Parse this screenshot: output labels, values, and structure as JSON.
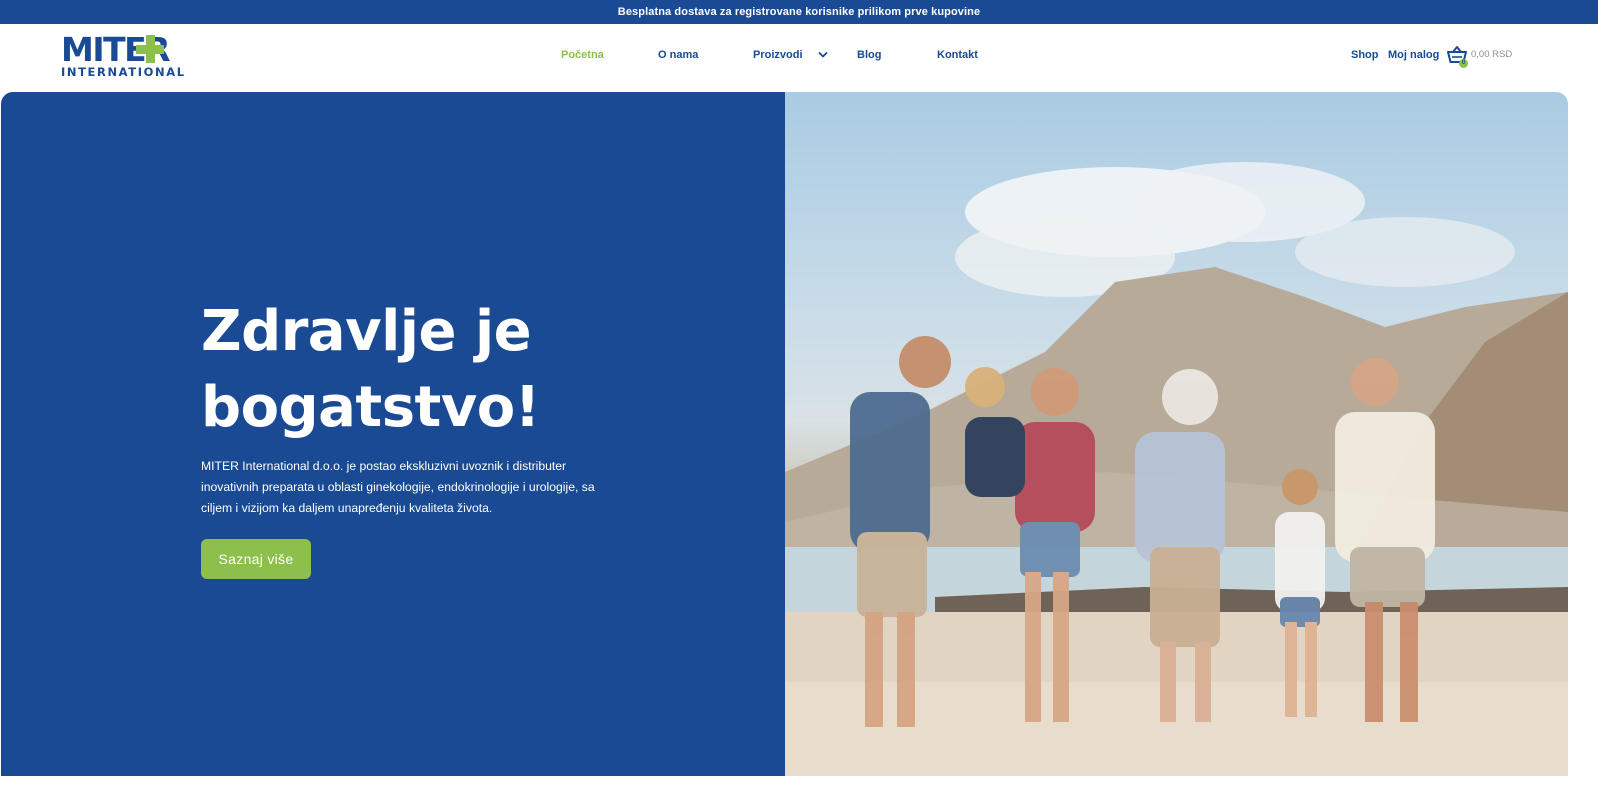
{
  "topbar": {
    "text": "Besplatna dostava za registrovane korisnike prilikom prve kupovine"
  },
  "logo": {
    "word": "MITER",
    "sub": "INTERNATIONAL"
  },
  "nav": {
    "items": [
      {
        "label": "Početna",
        "active": true
      },
      {
        "label": "O nama",
        "active": false
      },
      {
        "label": "Proizvodi",
        "active": false
      },
      {
        "label": "Blog",
        "active": false
      },
      {
        "label": "Kontakt",
        "active": false
      }
    ]
  },
  "header_right": {
    "shop": "Shop",
    "account": "Moj nalog",
    "cart_count": "0",
    "cart_total": "0,00 RSD"
  },
  "hero": {
    "title": "Zdravlje je bogatstvo!",
    "text": "MITER International d.o.o. je postao ekskluzivni uvoznik i distributer inovativnih preparata u oblasti ginekologije, endokrinologije i urologije, sa ciljem i vizijom ka daljem unapređenju kvaliteta života.",
    "cta": "Saznaj više"
  },
  "colors": {
    "brand_blue": "#194a93",
    "brand_green": "#8cc04b"
  },
  "icons": {
    "cart": "basket-icon",
    "dropdown": "chevron-down-icon"
  }
}
